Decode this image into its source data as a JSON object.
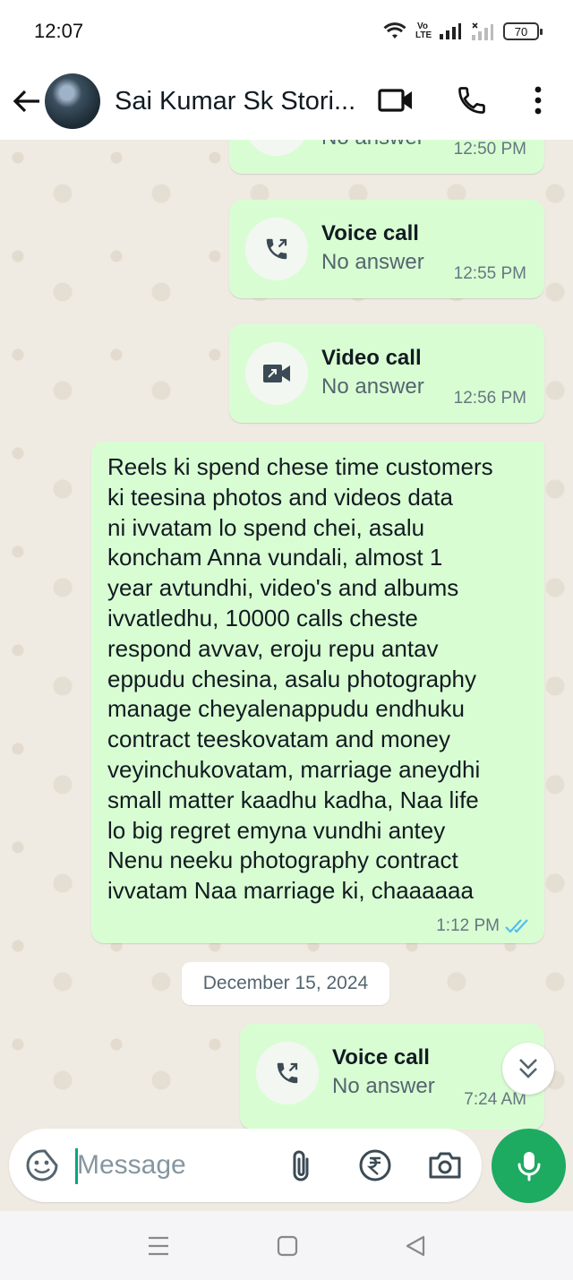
{
  "status_bar": {
    "time": "12:07",
    "battery": "70",
    "network_label": "Vo LTE"
  },
  "header": {
    "contact_name": "Sai Kumar Sk Stori..."
  },
  "messages": {
    "partial_call": {
      "sub": "No answer",
      "time": "12:50 PM"
    },
    "call1": {
      "title": "Voice call",
      "sub": "No answer",
      "time": "12:55 PM"
    },
    "call2": {
      "title": "Video call",
      "sub": "No answer",
      "time": "12:56 PM"
    },
    "text_msg": {
      "lines": [
        "Reels ki spend chese time customers",
        "ki teesina photos and videos data",
        "ni ivvatam lo spend chei, asalu",
        "koncham Anna vundali, almost 1",
        "year avtundhi, video's and albums",
        "ivvatledhu, 10000 calls cheste",
        "respond avvav, eroju repu antav",
        "eppudu chesina, asalu photography",
        "manage cheyalenappudu endhuku",
        "contract teeskovatam and money",
        "veyinchukovatam, marriage aneydhi",
        "small matter kaadhu kadha, Naa life",
        "lo big regret emyna vundhi antey",
        "Nenu neeku photography contract",
        "ivvatam Naa marriage ki, chaaaaaa"
      ],
      "time": "1:12 PM",
      "status": "read"
    },
    "date_divider": "December 15, 2024",
    "call3": {
      "title": "Voice call",
      "sub": "No answer",
      "time": "7:24 AM"
    }
  },
  "composer": {
    "placeholder": "Message"
  },
  "colors": {
    "bubble_out": "#d9fdd3",
    "accent": "#1daa61",
    "chat_bg": "#efeae2",
    "read_ticks": "#53bdeb"
  }
}
